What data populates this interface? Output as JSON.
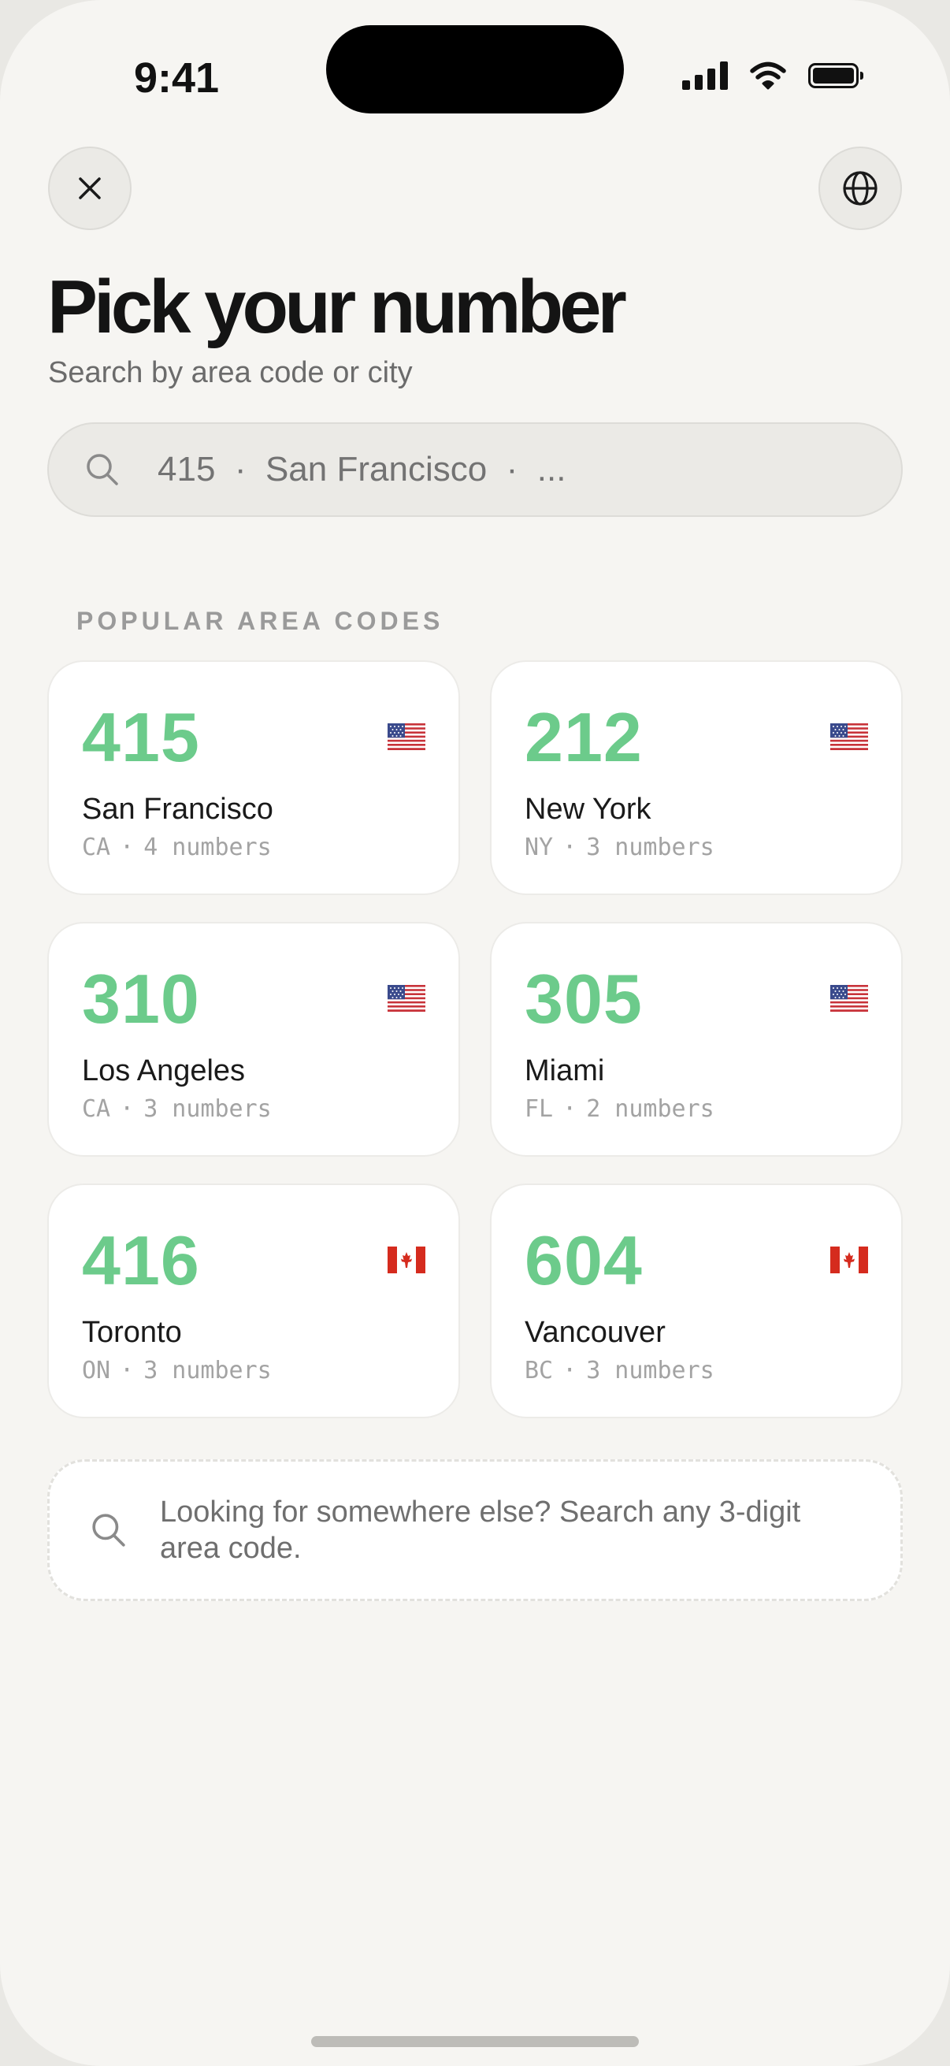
{
  "status_bar": {
    "time": "9:41"
  },
  "header": {
    "title": "Pick your number",
    "subtitle": "Search by area code or city"
  },
  "search": {
    "placeholder": "415  ·  San Francisco  ·  ..."
  },
  "section": {
    "label": "POPULAR AREA CODES"
  },
  "area_codes": [
    {
      "code": "415",
      "city": "San Francisco",
      "state": "CA",
      "numbers": "4 numbers",
      "flag": "us-flag-icon"
    },
    {
      "code": "212",
      "city": "New York",
      "state": "NY",
      "numbers": "3 numbers",
      "flag": "us-flag-icon"
    },
    {
      "code": "310",
      "city": "Los Angeles",
      "state": "CA",
      "numbers": "3 numbers",
      "flag": "us-flag-icon"
    },
    {
      "code": "305",
      "city": "Miami",
      "state": "FL",
      "numbers": "2 numbers",
      "flag": "us-flag-icon"
    },
    {
      "code": "416",
      "city": "Toronto",
      "state": "ON",
      "numbers": "3 numbers",
      "flag": "ca-flag-icon"
    },
    {
      "code": "604",
      "city": "Vancouver",
      "state": "BC",
      "numbers": "3 numbers",
      "flag": "ca-flag-icon"
    }
  ],
  "other_search": {
    "text": "Looking for somewhere else? Search any 3-digit area code."
  },
  "colors": {
    "accent_green": "#6ccb8b",
    "background": "#f6f5f2",
    "card": "#ffffff"
  },
  "icons": {
    "close": "close-icon",
    "globe": "globe-icon",
    "search": "search-icon"
  }
}
